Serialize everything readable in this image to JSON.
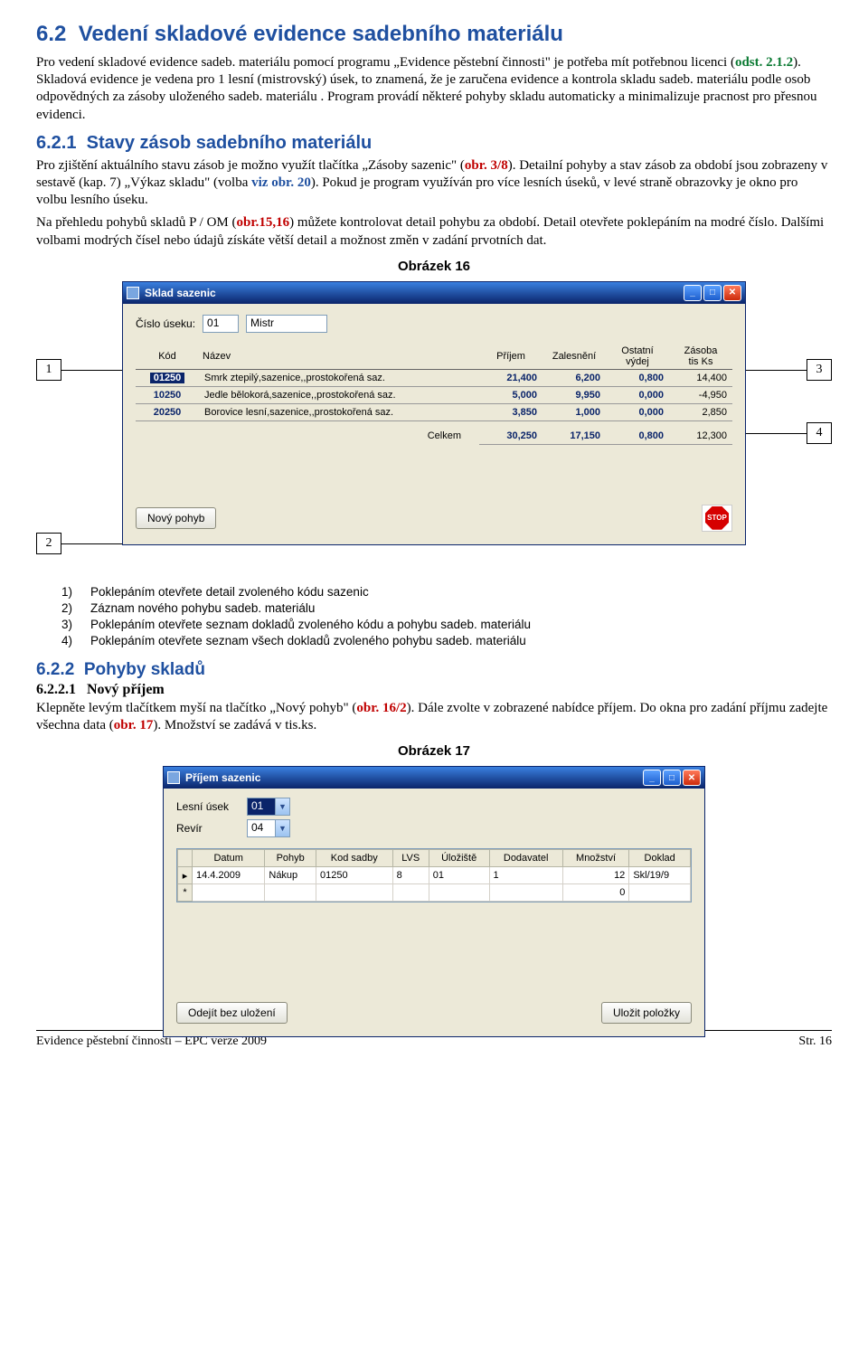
{
  "section": {
    "h1_num": "6.2",
    "h1_title": "Vedení skladové evidence sadebního materiálu",
    "p1a": "Pro vedení skladové evidence sadeb. materiálu pomocí programu „Evidence pěstební činnosti\" je potřeba mít potřebnou licenci (",
    "p1_ref": "odst. 2.1.2",
    "p1b": "). Skladová evidence je vedena pro 1 lesní (mistrovský) úsek, to znamená, že je zaručena evidence a kontrola skladu sadeb. materiálu podle osob odpovědných za zásoby uloženého sadeb. materiálu . Program provádí některé pohyby skladu automaticky a minimalizuje pracnost pro přesnou evidenci.",
    "h2_num": "6.2.1",
    "h2_title": "Stavy zásob sadebního materiálu",
    "p2a": "Pro zjištění aktuálního stavu zásob je možno využít tlačítka „Zásoby sazenic\" (",
    "p2_ref1": "obr. 3/8",
    "p2b": "). Detailní pohyby a stav zásob za období jsou zobrazeny v sestavě (kap. 7) „Výkaz skladu\" (volba ",
    "p2_ref2": "viz obr. 20",
    "p2c": "). Pokud je program využíván pro více lesních úseků, v levé straně obrazovky je okno pro volbu lesního úseku.",
    "p2d_a": "Na přehledu pohybů skladů P / OM (",
    "p2d_ref": "obr.15,16",
    "p2d_b": ") můžete kontrolovat detail pohybu za období. Detail otevřete poklepáním na modré číslo. Dalšími volbami modrých čísel nebo údajů získáte větší detail a možnost změn v zadání prvotních dat.",
    "caption16": "Obrázek 16",
    "caption17": "Obrázek 17"
  },
  "fig16": {
    "window_title": "Sklad sazenic",
    "lbl_cislo": "Číslo úseku:",
    "usek_val": "01",
    "usek_name": "Mistr",
    "cols": {
      "kod": "Kód",
      "nazev": "Název",
      "prijem": "Příjem",
      "zalesneni": "Zalesnění",
      "vydej_top": "Ostatní",
      "vydej_bot": "výdej",
      "zasoba_top": "Zásoba",
      "zasoba_bot": "tis Ks"
    },
    "rows": [
      {
        "kod": "01250",
        "nazev": "Smrk ztepilý,sazenice,,prostokořená saz.",
        "prijem": "21,400",
        "zal": "6,200",
        "vydej": "0,800",
        "zasoba": "14,400"
      },
      {
        "kod": "10250",
        "nazev": "Jedle bělokorá,sazenice,,prostokořená saz.",
        "prijem": "5,000",
        "zal": "9,950",
        "vydej": "0,000",
        "zasoba": "-4,950"
      },
      {
        "kod": "20250",
        "nazev": "Borovice lesní,sazenice,,prostokořená saz.",
        "prijem": "3,850",
        "zal": "1,000",
        "vydej": "0,000",
        "zasoba": "2,850"
      }
    ],
    "total_lbl": "Celkem",
    "totals": {
      "prijem": "30,250",
      "zal": "17,150",
      "vydej": "0,800",
      "zasoba": "12,300"
    },
    "btn_novy": "Nový pohyb",
    "stop": "STOP",
    "callouts": {
      "c1": "1",
      "c2": "2",
      "c3": "3",
      "c4": "4"
    }
  },
  "list16": {
    "i1n": "1)",
    "i1t": "Poklepáním otevřete detail zvoleného kódu sazenic",
    "i2n": "2)",
    "i2t": "Záznam nového pohybu sadeb. materiálu",
    "i3n": "3)",
    "i3t": "Poklepáním otevřete seznam dokladů zvoleného kódu a pohybu sadeb. materiálu",
    "i4n": "4)",
    "i4t": "Poklepáním otevřete seznam všech dokladů zvoleného pohybu sadeb. materiálu"
  },
  "sec622": {
    "h3_num": "6.2.2",
    "h3_title": "Pohyby skladů",
    "h4_num": "6.2.2.1",
    "h4_title": "Nový příjem",
    "pa": "Klepněte levým tlačítkem myší na tlačítko „Nový pohyb\" (",
    "pref": "obr. 16/2",
    "pb": "). Dále zvolte v zobrazené nabídce příjem. Do okna pro zadání příjmu zadejte všechna data (",
    "pref2": "obr. 17",
    "pc": "). Množství se zadává v tis.ks."
  },
  "fig17": {
    "window_title": "Příjem sazenic",
    "lbl_usek": "Lesní úsek",
    "usek_val": "01",
    "lbl_revir": "Revír",
    "revir_val": "04",
    "cols": {
      "datum": "Datum",
      "pohyb": "Pohyb",
      "kod": "Kod sadby",
      "lvs": "LVS",
      "uloziste": "Úložiště",
      "dodavatel": "Dodavatel",
      "mnozstvi": "Množství",
      "doklad": "Doklad"
    },
    "row": {
      "datum": "14.4.2009",
      "pohyb": "Nákup",
      "kod": "01250",
      "lvs": "8",
      "uloziste": "01",
      "dodavatel": "1",
      "mnozstvi": "12",
      "doklad": "Skl/19/9"
    },
    "row2_mnozstvi": "0",
    "btn_cancel": "Odejít bez uložení",
    "btn_save": "Uložit položky"
  },
  "footer": {
    "left": "Evidence pěstební činnosti – EPC verze 2009",
    "right": "Str. 16"
  }
}
